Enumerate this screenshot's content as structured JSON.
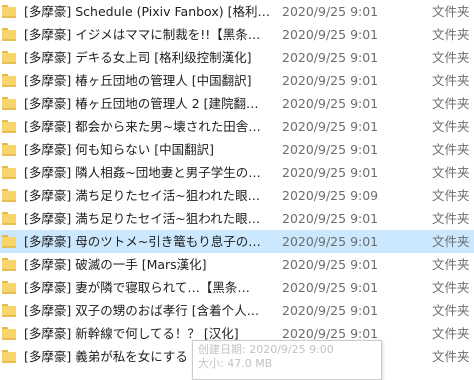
{
  "files": [
    {
      "name": "[多摩豪] Schedule (Pixiv Fanbox) [格利…",
      "date": "2020/9/25 9:01",
      "type": "文件夹"
    },
    {
      "name": "[多摩豪] イジメはママに制裁を!!【黑条…",
      "date": "2020/9/25 9:01",
      "type": "文件夹"
    },
    {
      "name": "[多摩豪] デキる女上司 [格利级控制漢化]",
      "date": "2020/9/25 9:01",
      "type": "文件夹"
    },
    {
      "name": "[多摩豪] 椿ヶ丘団地の管理人 [中国翻訳]",
      "date": "2020/9/25 9:01",
      "type": "文件夹"
    },
    {
      "name": "[多摩豪] 椿ヶ丘団地の管理人 2 [建院翻…",
      "date": "2020/9/25 9:01",
      "type": "文件夹"
    },
    {
      "name": "[多摩豪] 都会から来た男~壊された田舎…",
      "date": "2020/9/25 9:01",
      "type": "文件夹"
    },
    {
      "name": "[多摩豪] 何も知らない [中国翻訳]",
      "date": "2020/9/25 9:01",
      "type": "文件夹"
    },
    {
      "name": "[多摩豪] 隣人相姦~団地妻と男子学生の…",
      "date": "2020/9/25 9:01",
      "type": "文件夹"
    },
    {
      "name": "[多摩豪] 満ち足りたセイ活~狙われた眼…",
      "date": "2020/9/25 9:09",
      "type": "文件夹"
    },
    {
      "name": "[多摩豪] 満ち足りたセイ活~狙われた眼…",
      "date": "2020/9/25 9:01",
      "type": "文件夹"
    },
    {
      "name": "[多摩豪] 母のツトメ~引き篭もり息子の…",
      "date": "2020/9/25 9:01",
      "type": "文件夹",
      "selected": true
    },
    {
      "name": "[多摩豪] 破滅の一手 [Mars漢化]",
      "date": "2020/9/25 9:01",
      "type": "文件夹"
    },
    {
      "name": "[多摩豪] 妻が隣で寝取られて…【黑条…",
      "date": "2020/9/25 9:01",
      "type": "文件夹"
    },
    {
      "name": "[多摩豪] 双子の甥のおば孝行 [含着个人…",
      "date": "2020/9/25 9:01",
      "type": "文件夹"
    },
    {
      "name": "[多摩豪] 新幹線で何してる！？ [汉化]",
      "date": "2020/9/25 9:01",
      "type": "文件夹"
    },
    {
      "name": "[多摩豪] 義弟が私を女にする",
      "date": "2020/9/25 9:01",
      "type": "文件夹"
    }
  ],
  "tooltip": {
    "line1": "创建日期: 2020/9/25 9:00",
    "line2": "大小: 47.0 MB"
  }
}
